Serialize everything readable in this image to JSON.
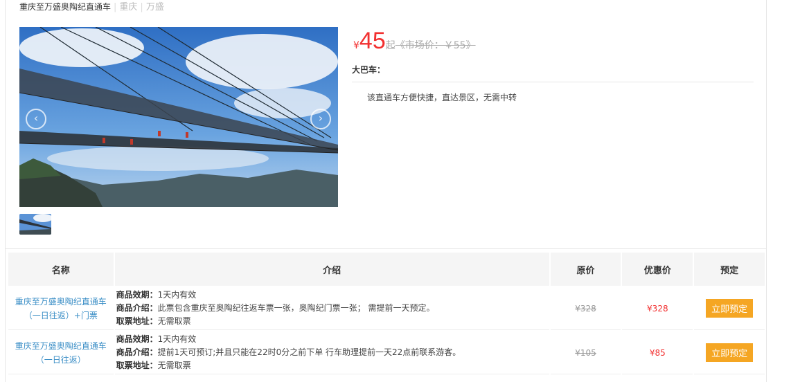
{
  "header": {
    "title": "重庆至万盛奥陶纪直通车",
    "tags": [
      "重庆",
      "万盛"
    ]
  },
  "gallery": {
    "prev_glyph": "‹",
    "next_glyph": "›"
  },
  "price": {
    "currency": "¥",
    "amount": "45",
    "suffix": "起",
    "market_label": "《市场价：￥55》"
  },
  "bus": {
    "label": "大巴车：",
    "description": "该直通车方便快捷，直达景区，无需中转"
  },
  "table": {
    "headers": [
      "名称",
      "介绍",
      "原价",
      "优惠价",
      "预定"
    ],
    "rows": [
      {
        "name": "重庆至万盛奥陶纪直通车（一日往返）+门票",
        "validity_label": "商品效期：",
        "validity": "1天内有效",
        "intro_label": "商品介绍：",
        "intro": "此票包含重庆至奥陶纪往返车票一张，奥陶纪门票一张； 需提前一天预定。",
        "pickup_label": "取票地址：",
        "pickup": "无需取票",
        "original_price": "¥328",
        "sale_price": "¥328",
        "button": "立即预定"
      },
      {
        "name": "重庆至万盛奥陶纪直通车（一日往返）",
        "validity_label": "商品效期：",
        "validity": "1天内有效",
        "intro_label": "商品介绍：",
        "intro": "提前1天可预订;并且只能在22时0分之前下单 行车助理提前一天22点前联系游客。",
        "pickup_label": "取票地址：",
        "pickup": "无需取票",
        "original_price": "¥105",
        "sale_price": "¥85",
        "button": "立即预定"
      }
    ]
  },
  "colors": {
    "price_red": "#f23030",
    "link_blue": "#3a8ec6",
    "button_orange": "#f5a623"
  }
}
